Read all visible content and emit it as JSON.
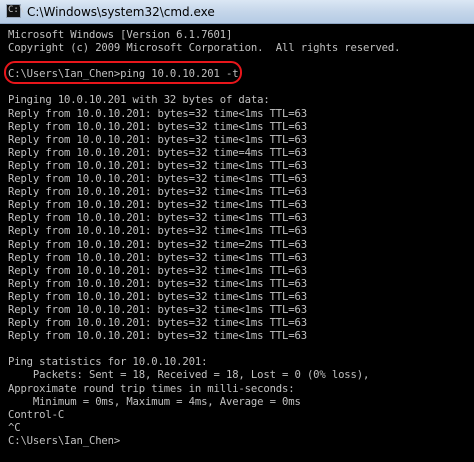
{
  "window": {
    "title": "C:\\Windows\\system32\\cmd.exe",
    "icon": "cmd-icon",
    "icon_glyph": "C:\\"
  },
  "console": {
    "lines": [
      "Microsoft Windows [Version 6.1.7601]",
      "Copyright (c) 2009 Microsoft Corporation.  All rights reserved.",
      "",
      "C:\\Users\\Ian_Chen>ping 10.0.10.201 -t",
      "",
      "Pinging 10.0.10.201 with 32 bytes of data:",
      "Reply from 10.0.10.201: bytes=32 time<1ms TTL=63",
      "Reply from 10.0.10.201: bytes=32 time<1ms TTL=63",
      "Reply from 10.0.10.201: bytes=32 time<1ms TTL=63",
      "Reply from 10.0.10.201: bytes=32 time=4ms TTL=63",
      "Reply from 10.0.10.201: bytes=32 time<1ms TTL=63",
      "Reply from 10.0.10.201: bytes=32 time<1ms TTL=63",
      "Reply from 10.0.10.201: bytes=32 time<1ms TTL=63",
      "Reply from 10.0.10.201: bytes=32 time<1ms TTL=63",
      "Reply from 10.0.10.201: bytes=32 time<1ms TTL=63",
      "Reply from 10.0.10.201: bytes=32 time<1ms TTL=63",
      "Reply from 10.0.10.201: bytes=32 time=2ms TTL=63",
      "Reply from 10.0.10.201: bytes=32 time<1ms TTL=63",
      "Reply from 10.0.10.201: bytes=32 time<1ms TTL=63",
      "Reply from 10.0.10.201: bytes=32 time<1ms TTL=63",
      "Reply from 10.0.10.201: bytes=32 time<1ms TTL=63",
      "Reply from 10.0.10.201: bytes=32 time<1ms TTL=63",
      "Reply from 10.0.10.201: bytes=32 time<1ms TTL=63",
      "Reply from 10.0.10.201: bytes=32 time<1ms TTL=63",
      "",
      "Ping statistics for 10.0.10.201:",
      "    Packets: Sent = 18, Received = 18, Lost = 0 (0% loss),",
      "Approximate round trip times in milli-seconds:",
      "    Minimum = 0ms, Maximum = 4ms, Average = 0ms",
      "Control-C",
      "^C",
      "C:\\Users\\Ian_Chen>"
    ]
  },
  "colors": {
    "console_background": "#000000",
    "console_text": "#c0c0c0",
    "highlight": "#e8161b"
  }
}
